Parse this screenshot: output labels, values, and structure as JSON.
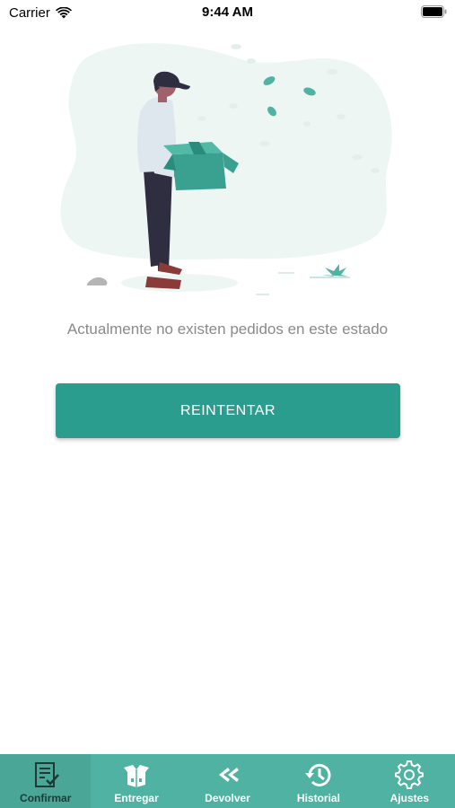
{
  "status_bar": {
    "carrier": "Carrier",
    "time": "9:44 AM"
  },
  "empty_state": {
    "message": "Actualmente no existen pedidos en este estado",
    "illustration": "delivery-person-empty-box"
  },
  "retry_button": {
    "label": "REINTENTAR"
  },
  "tabs": [
    {
      "label": "Confirmar",
      "icon": "checklist-icon",
      "active": true
    },
    {
      "label": "Entregar",
      "icon": "open-box-icon",
      "active": false
    },
    {
      "label": "Devolver",
      "icon": "double-chevron-left-icon",
      "active": false
    },
    {
      "label": "Historial",
      "icon": "history-icon",
      "active": false
    },
    {
      "label": "Ajustes",
      "icon": "gear-icon",
      "active": false
    }
  ],
  "colors": {
    "accent": "#2b9d8f",
    "tab_bar": "#4fb2a2",
    "tab_active_label": "#1e3a36"
  }
}
